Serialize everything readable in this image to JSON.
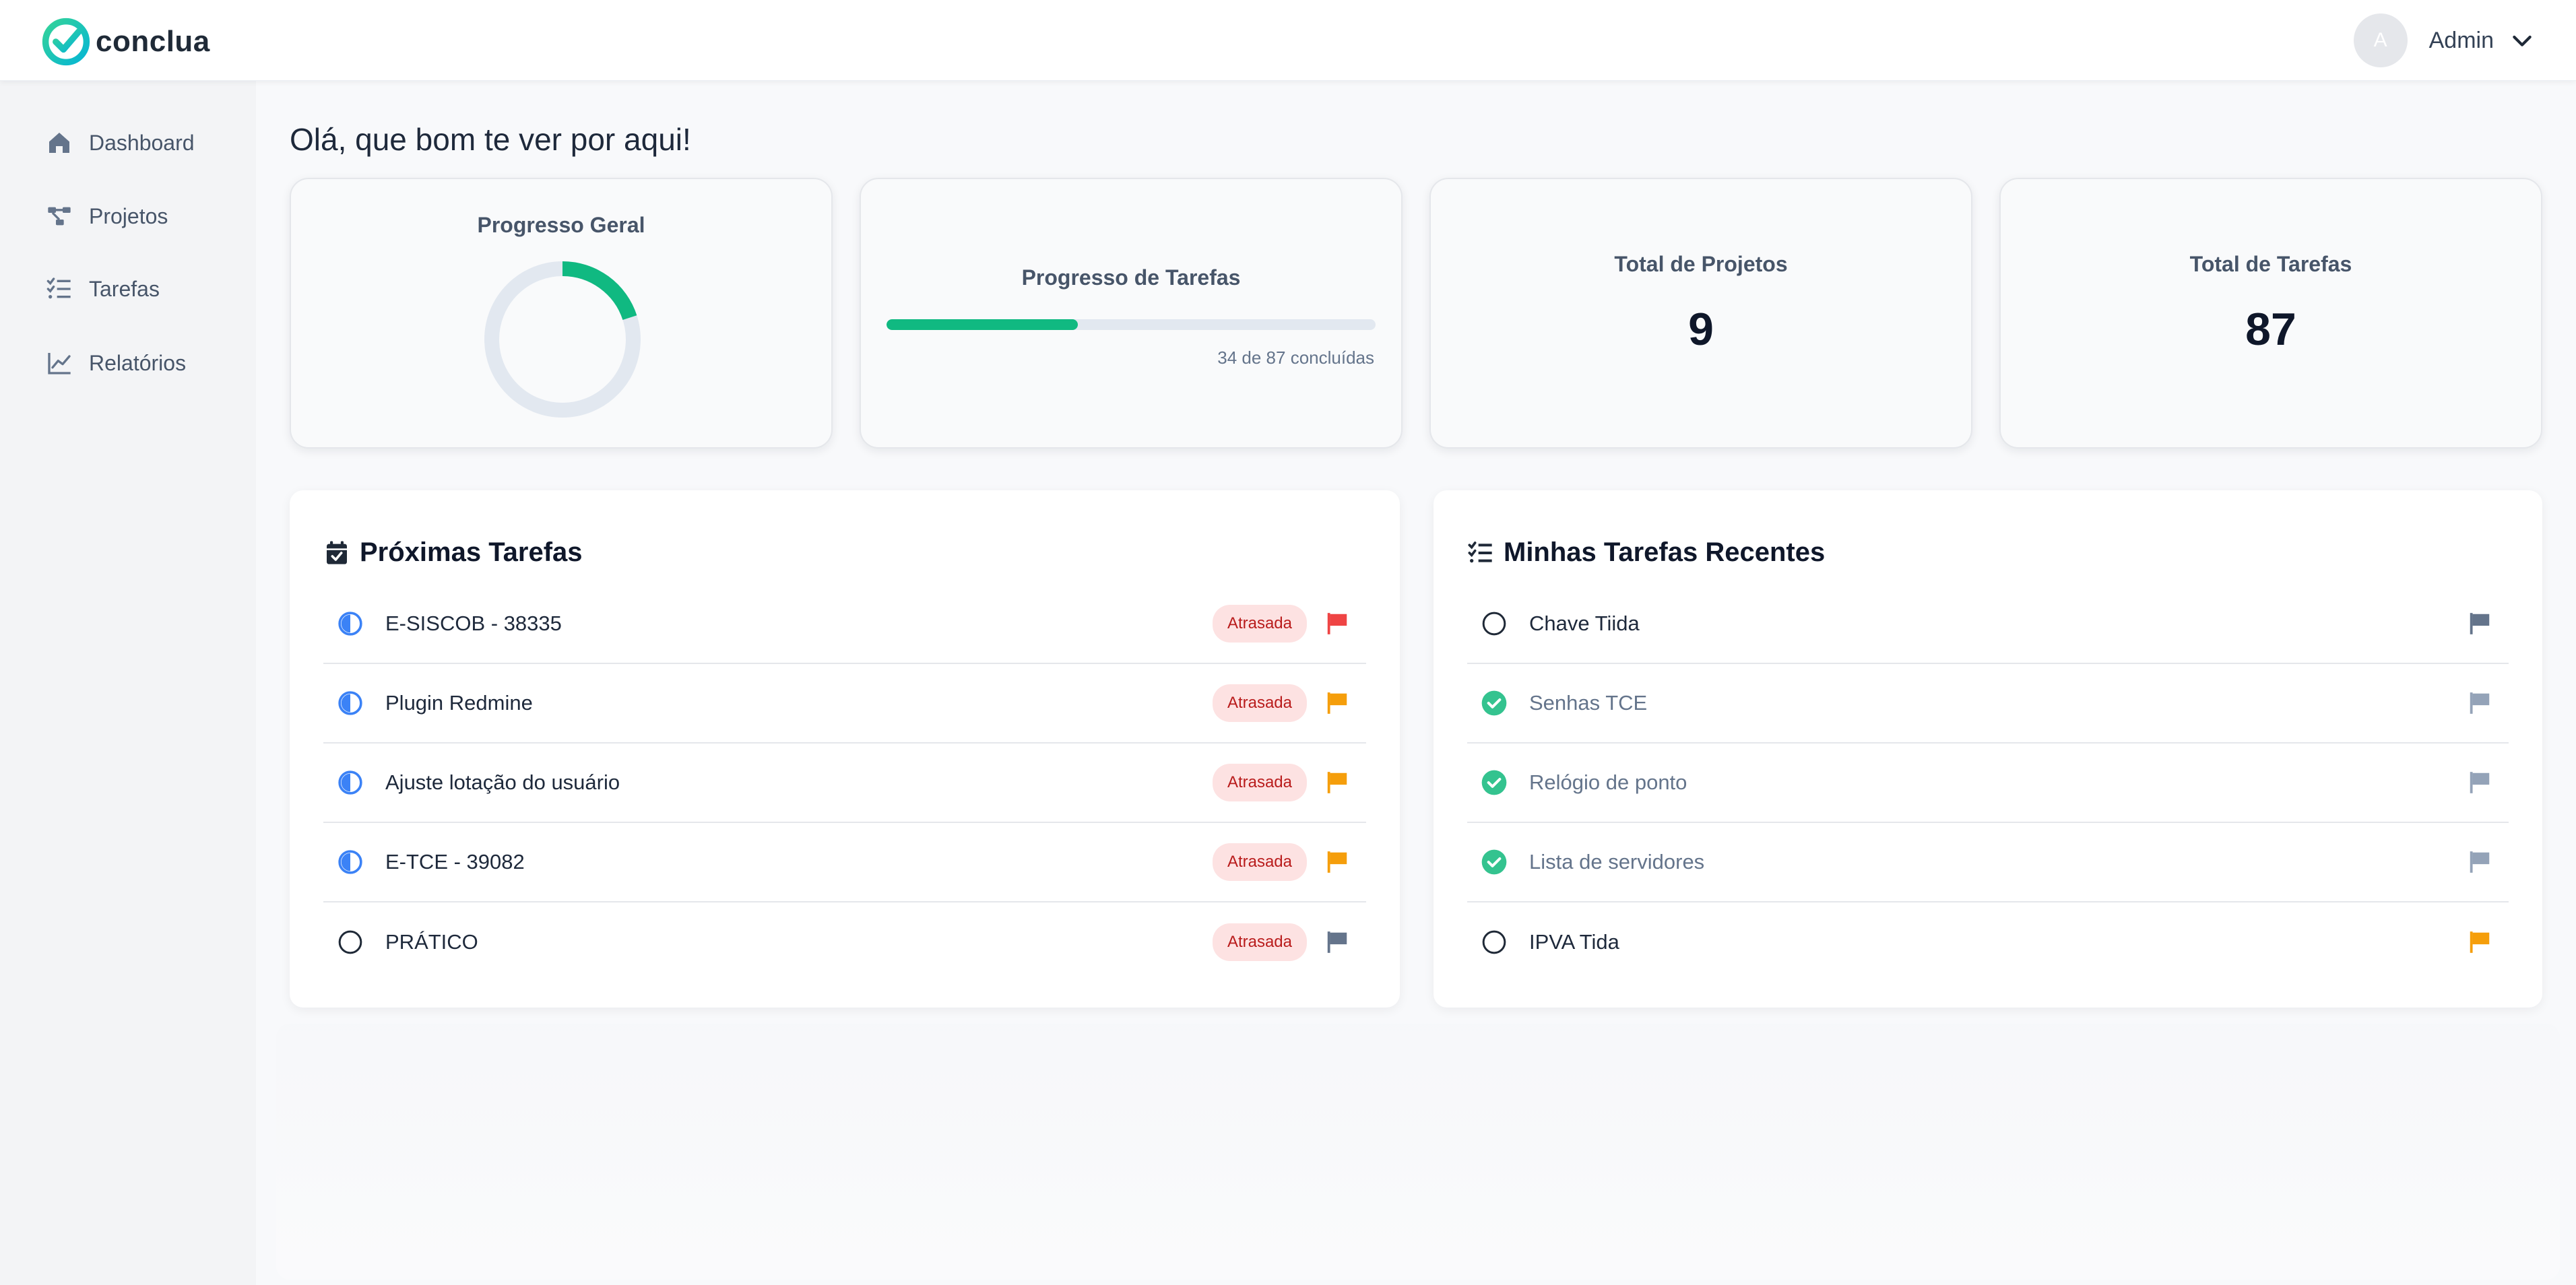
{
  "app": {
    "brand": "conclua",
    "accent_color": "#10b981",
    "logo_icon": "check-circle-icon"
  },
  "user": {
    "avatar_initial": "A",
    "name": "Admin"
  },
  "sidebar": {
    "items": [
      {
        "label": "Dashboard",
        "icon": "home-icon"
      },
      {
        "label": "Projetos",
        "icon": "project-tree-icon"
      },
      {
        "label": "Tarefas",
        "icon": "task-list-icon"
      },
      {
        "label": "Relatórios",
        "icon": "line-chart-icon"
      }
    ]
  },
  "main": {
    "greeting": "Olá, que bom te ver por aqui!",
    "stats": {
      "overall_progress": {
        "title": "Progresso Geral",
        "fraction": 0.2
      },
      "task_progress": {
        "title": "Progresso de Tarefas",
        "completed": 34,
        "total": 87,
        "text": "34 de 87 concluídas"
      },
      "total_projects": {
        "title": "Total de Projetos",
        "value": "9"
      },
      "total_tasks": {
        "title": "Total de Tarefas",
        "value": "87"
      }
    },
    "upcoming": {
      "title": "Próximas Tarefas",
      "icon": "calendar-check-icon",
      "items": [
        {
          "label": "E-SISCOB - 38335",
          "status": "in-progress",
          "badge": "Atrasada",
          "flag_color": "#ef4444"
        },
        {
          "label": "Plugin Redmine",
          "status": "in-progress",
          "badge": "Atrasada",
          "flag_color": "#f59e0b"
        },
        {
          "label": "Ajuste lotação do usuário",
          "status": "in-progress",
          "badge": "Atrasada",
          "flag_color": "#f59e0b"
        },
        {
          "label": "E-TCE - 39082",
          "status": "in-progress",
          "badge": "Atrasada",
          "flag_color": "#f59e0b"
        },
        {
          "label": "PRÁTICO",
          "status": "open",
          "badge": "Atrasada",
          "flag_color": "#64748b"
        }
      ]
    },
    "recent": {
      "title": "Minhas Tarefas Recentes",
      "icon": "list-check-icon",
      "items": [
        {
          "label": "Chave Tiida",
          "status": "open",
          "flag_color": "#64748b"
        },
        {
          "label": "Senhas TCE",
          "status": "done",
          "flag_color": "#94a3b8"
        },
        {
          "label": "Relógio de ponto",
          "status": "done",
          "flag_color": "#94a3b8"
        },
        {
          "label": "Lista de servidores",
          "status": "done",
          "flag_color": "#94a3b8"
        },
        {
          "label": "IPVA Tida",
          "status": "open",
          "flag_color": "#f59e0b"
        }
      ]
    }
  }
}
